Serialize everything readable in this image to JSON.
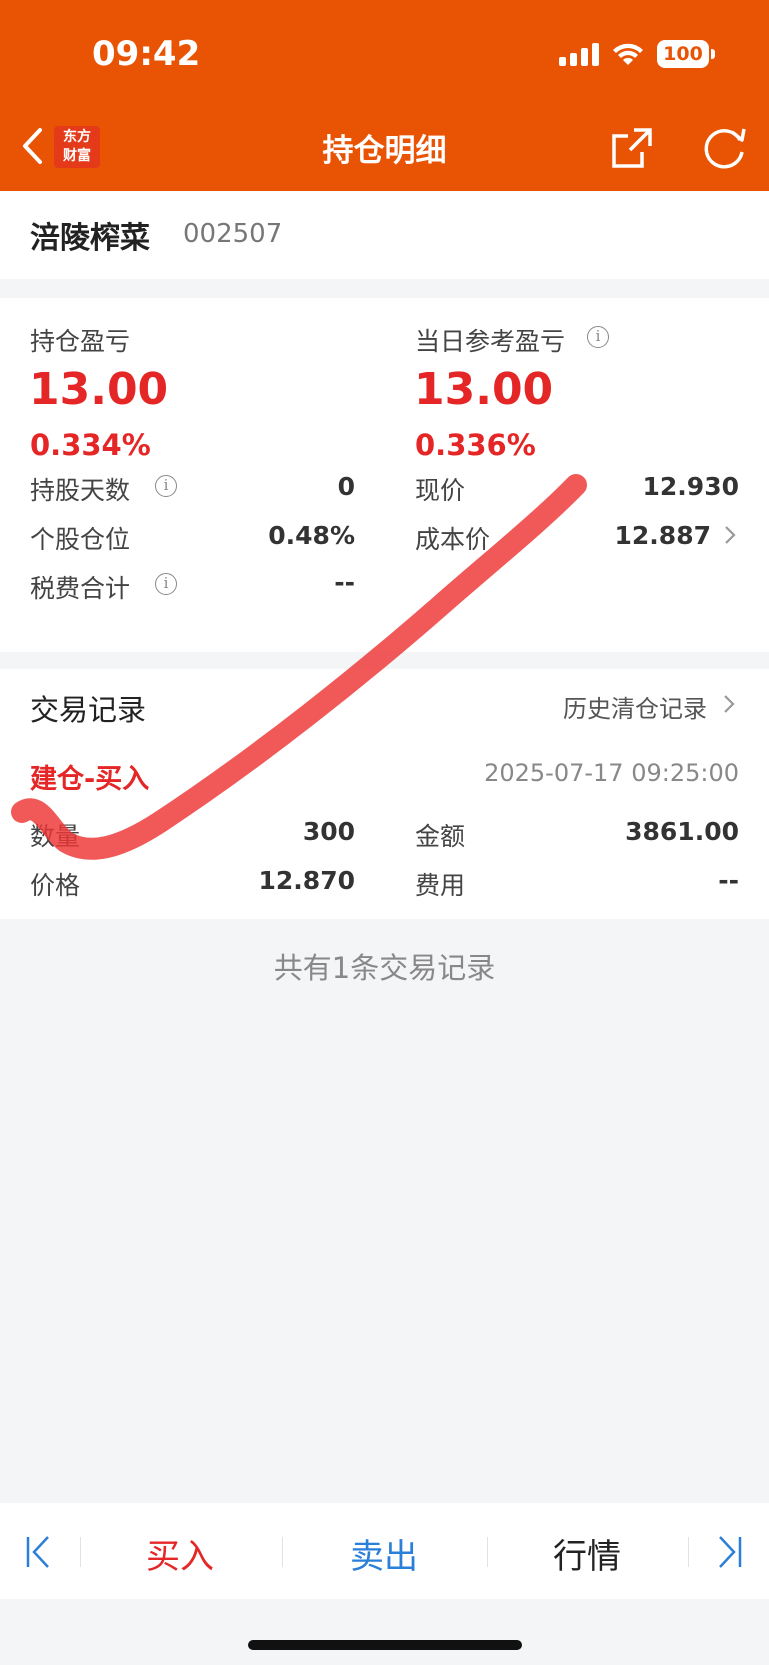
{
  "status_bar": {
    "time": "09:42",
    "battery": "100"
  },
  "nav": {
    "logo_line1": "东方",
    "logo_line2": "财富",
    "title": "持仓明细"
  },
  "stock": {
    "name": "涪陵榨菜",
    "code": "002507"
  },
  "position": {
    "holding_pnl_label": "持仓盈亏",
    "holding_pnl_value": "13.00",
    "holding_pnl_pct": "0.334%",
    "daily_pnl_label": "当日参考盈亏",
    "daily_pnl_value": "13.00",
    "daily_pnl_pct": "0.336%",
    "hold_days_label": "持股天数",
    "hold_days_value": "0",
    "current_price_label": "现价",
    "current_price_value": "12.930",
    "position_ratio_label": "个股仓位",
    "position_ratio_value": "0.48%",
    "cost_price_label": "成本价",
    "cost_price_value": "12.887",
    "tax_label": "税费合计",
    "tax_value": "--",
    "info_glyph": "i"
  },
  "trades": {
    "section_title": "交易记录",
    "history_link": "历史清仓记录",
    "records": [
      {
        "type": "建仓-买入",
        "time": "2025-07-17 09:25:00",
        "quantity_label": "数量",
        "quantity_value": "300",
        "amount_label": "金额",
        "amount_value": "3861.00",
        "price_label": "价格",
        "price_value": "12.870",
        "fee_label": "费用",
        "fee_value": "--"
      }
    ],
    "footer_note": "共有1条交易记录"
  },
  "toolbar": {
    "buy_label": "买入",
    "sell_label": "卖出",
    "quote_label": "行情"
  },
  "colors": {
    "brand_orange": "#e95404",
    "profit_red": "#e52626",
    "link_blue": "#2a7fd8"
  }
}
